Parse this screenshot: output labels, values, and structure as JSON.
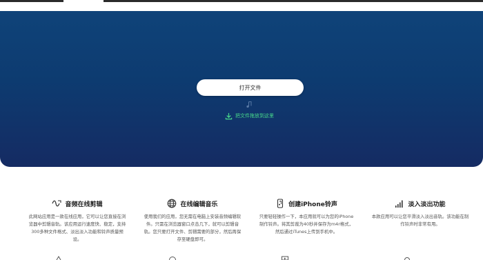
{
  "hero": {
    "open_button_label": "打开文件",
    "drop_hint": "把文件拖放到这里",
    "accent_color": "#48d98b",
    "background_color": "#0f4379"
  },
  "features": [
    {
      "icon": "audio-wave-icon",
      "title": "音频在线剪辑",
      "description": "此网站应用是一款在线应用，它可以让您直接在浏览器中剪辑音轨。该应用运行速度快、稳定，支持300多种文件格式、淡出淡入功能和铃声质量预设。"
    },
    {
      "icon": "globe-icon",
      "title": "在线编辑音乐",
      "description": "使用我们的应用，您无需在电脑上安装音频编辑软件。只需在浏览器窗口点击几下，就可以剪辑音轨。您只要打开文件、剪辑需要的部分，然后再保存至硬盘即可。"
    },
    {
      "icon": "phone-ringtone-icon",
      "title": "创建iPhone铃声",
      "description": "只要轻轻操作一下，本应用就可以为您的iPhone制作铃声。将其剪裁为40秒并保存为m4r格式，然后通过iTunes上传到手机中。"
    },
    {
      "icon": "signal-bars-icon",
      "title": "淡入淡出功能",
      "description": "本款应用可以让您平滑淡入淡出音轨。该功能在制作铃声时非常有用。"
    }
  ]
}
